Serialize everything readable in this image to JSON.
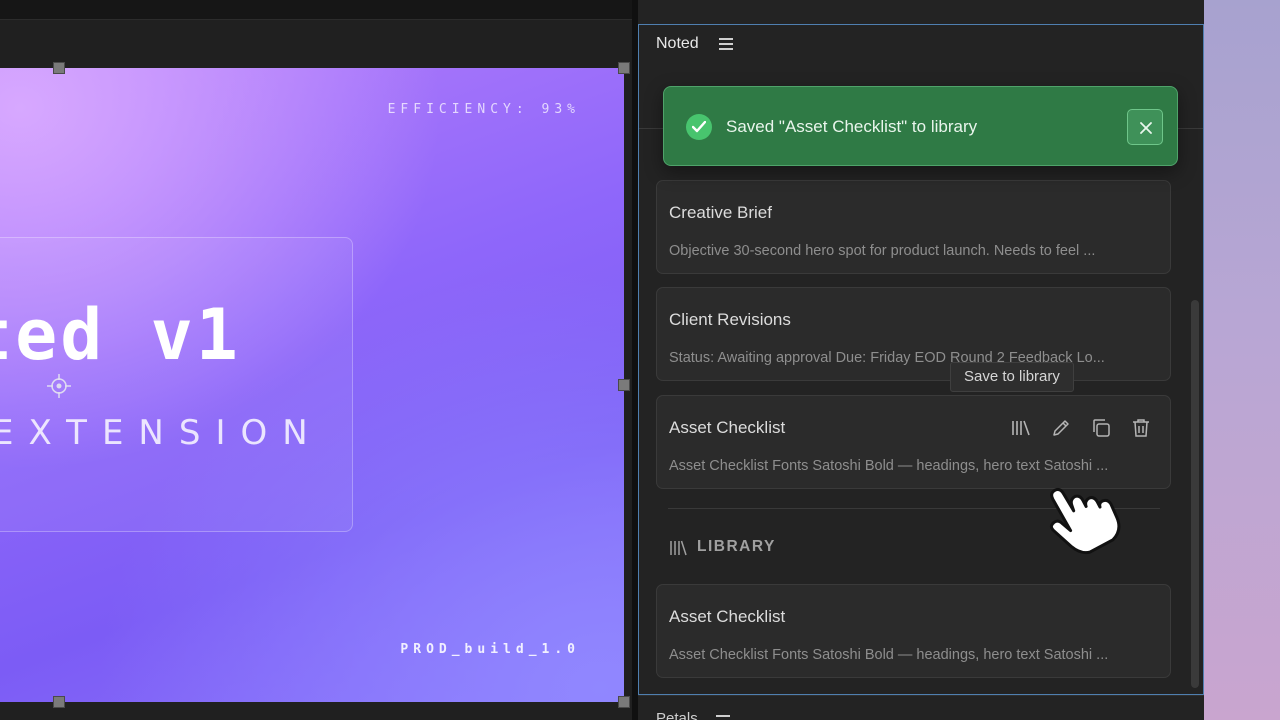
{
  "artboard": {
    "efficiency": "EFFICIENCY: 93%",
    "hero_title": "ted v1",
    "hero_subtitle": "EXTENSION",
    "build": "PROD_build_1.0"
  },
  "panel": {
    "title": "Noted",
    "menu_icon": "hamburger-icon",
    "toast": {
      "message": "Saved \"Asset Checklist\" to library",
      "status_color": "#48c46e"
    },
    "notes": [
      {
        "title": "Creative Brief",
        "preview": "Objective 30-second hero spot for product launch. Needs to feel ..."
      },
      {
        "title": "Client Revisions",
        "preview": "Status: Awaiting approval Due: Friday EOD Round 2 Feedback Lo..."
      },
      {
        "title": "Asset Checklist",
        "preview": "Asset Checklist Fonts Satoshi Bold — headings, hero text Satoshi ...",
        "actions": [
          "library-icon",
          "edit-icon",
          "copy-icon",
          "trash-icon"
        ]
      }
    ],
    "tooltip": "Save to library",
    "library": {
      "heading": "LIBRARY",
      "items": [
        {
          "title": "Asset Checklist",
          "preview": "Asset Checklist Fonts Satoshi Bold — headings, hero text Satoshi ..."
        }
      ]
    },
    "bottom_panel_title": "Petals"
  },
  "colors": {
    "accent_border": "#4f7fb0",
    "toast_bg": "#2f7a45",
    "artboard_gradient": [
      "#d7a8ff",
      "#8f67fa",
      "#7c5cf5"
    ]
  }
}
